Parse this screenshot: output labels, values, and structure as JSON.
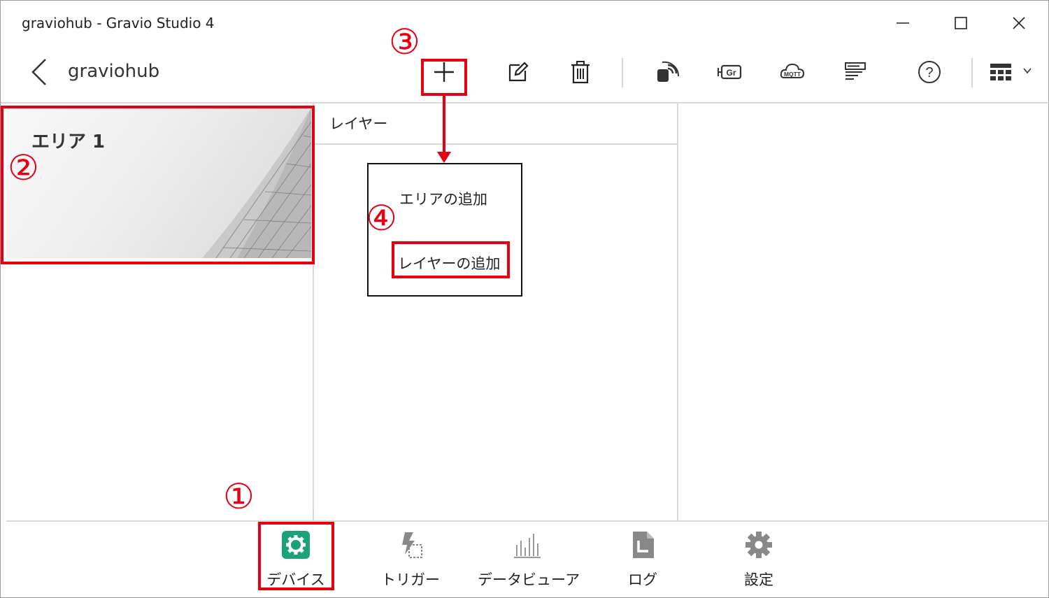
{
  "window": {
    "title": "graviohub - Gravio Studio 4",
    "controls": {
      "minimize_icon": "minimize-icon",
      "maximize_icon": "maximize-icon",
      "close_icon": "close-icon"
    }
  },
  "toolbar": {
    "page_title": "graviohub",
    "buttons": [
      "add-icon",
      "edit-icon",
      "delete-icon",
      "sensor-icon",
      "gateway-icon",
      "mqtt-icon",
      "list-icon",
      "help-icon",
      "view-icon"
    ],
    "add_icon_text": "+",
    "gateway_label": "Gr",
    "mqtt_label": "MQTT",
    "help_label": "?"
  },
  "area_panel": {
    "areas": [
      {
        "name": "エリア 1"
      }
    ]
  },
  "layer_panel": {
    "header": "レイヤー"
  },
  "add_menu": {
    "items": [
      "エリアの追加",
      "レイヤーの追加"
    ]
  },
  "bottom_nav": {
    "items": [
      {
        "label": "デバイス",
        "icon": "devices-icon",
        "active": true
      },
      {
        "label": "トリガー",
        "icon": "trigger-icon",
        "active": false
      },
      {
        "label": "データビューア",
        "icon": "data-viewer-icon",
        "active": false
      },
      {
        "label": "ログ",
        "icon": "log-icon",
        "active": false
      },
      {
        "label": "設定",
        "icon": "settings-icon",
        "active": false
      }
    ]
  },
  "annotations": {
    "color": "#e60012",
    "numbers": [
      "①",
      "②",
      "③",
      "④"
    ]
  },
  "colors": {
    "accent": "#1aa37a",
    "annotation_red": "#e60012"
  }
}
